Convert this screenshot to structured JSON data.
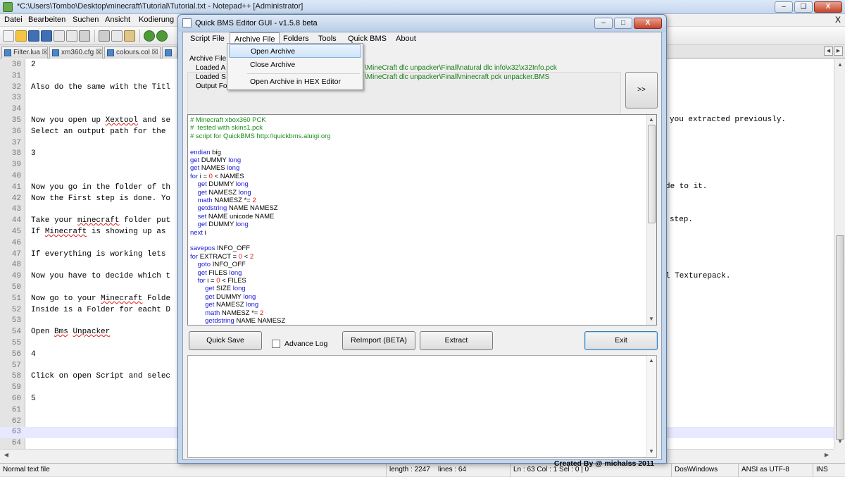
{
  "npp": {
    "title": "*C:\\Users\\Tombo\\Desktop\\minecraft\\Tutorial\\Tutorial.txt - Notepad++ [Administrator]",
    "menu": [
      "Datei",
      "Bearbeiten",
      "Suchen",
      "Ansicht",
      "Kodierung"
    ],
    "menu_close": "X",
    "tabs": [
      "Filter.lua",
      "xm360.cfg",
      "colours.col"
    ],
    "lines": [
      {
        "num": "30",
        "text": "2"
      },
      {
        "num": "31",
        "text": ""
      },
      {
        "num": "32",
        "text": "Also do the same with the Titl"
      },
      {
        "num": "33",
        "text": ""
      },
      {
        "num": "34",
        "text": ""
      },
      {
        "num": "35",
        "text": "Now you open up Xextool and se"
      },
      {
        "num": "36",
        "text": "Select an output path for the"
      },
      {
        "num": "37",
        "text": ""
      },
      {
        "num": "38",
        "text": "3"
      },
      {
        "num": "39",
        "text": ""
      },
      {
        "num": "40",
        "text": ""
      },
      {
        "num": "41",
        "text": "Now you go in the folder of th"
      },
      {
        "num": "42",
        "text": "Now the First step is done. Yo"
      },
      {
        "num": "43",
        "text": ""
      },
      {
        "num": "44",
        "text": "Take your minecraft folder put"
      },
      {
        "num": "45",
        "text": "If Minecraft is showing up as"
      },
      {
        "num": "46",
        "text": ""
      },
      {
        "num": "47",
        "text": "If everything is working lets"
      },
      {
        "num": "48",
        "text": ""
      },
      {
        "num": "49",
        "text": "Now you have to decide which t"
      },
      {
        "num": "50",
        "text": ""
      },
      {
        "num": "51",
        "text": "Now go to your Minecraft Folde"
      },
      {
        "num": "52",
        "text": "Inside is a Folder for eacht D"
      },
      {
        "num": "53",
        "text": ""
      },
      {
        "num": "54",
        "text": "Open Bms Unpacker"
      },
      {
        "num": "55",
        "text": ""
      },
      {
        "num": "56",
        "text": "4"
      },
      {
        "num": "57",
        "text": ""
      },
      {
        "num": "58",
        "text": "Click on open Script and selec"
      },
      {
        "num": "59",
        "text": ""
      },
      {
        "num": "60",
        "text": "5"
      },
      {
        "num": "61",
        "text": ""
      },
      {
        "num": "62",
        "text": ""
      },
      {
        "num": "63",
        "text": ""
      },
      {
        "num": "64",
        "text": ""
      }
    ],
    "right_texts": {
      "l35": "you extracted previously.",
      "l41": "de to it.",
      "l44": "step.",
      "l49": "l Texturepack."
    },
    "status": {
      "type": "Normal text file",
      "length": "length : 2247",
      "lines": "lines : 64",
      "pos": "Ln : 63   Col : 1   Sel : 0 | 0",
      "eol": "Dos\\Windows",
      "encoding": "ANSI as UTF-8",
      "mode": "INS"
    }
  },
  "qbms": {
    "title": "Quick BMS Editor GUI - v1.5.8 beta",
    "menu": [
      "Script File",
      "Archive File",
      "Folders",
      "Tools",
      "Quick BMS",
      "About"
    ],
    "archive_label": "Archive File",
    "loaded_archive_label": "Loaded A",
    "loaded_script_label": "Loaded S",
    "output_label": "Output Fo",
    "loaded_archive_path": "\\MineCraft dlc unpacker\\Finall\\natural dlc info\\x32\\x32Info.pck",
    "loaded_script_path": "\\MineCraft dlc unpacker\\Finall\\minecraft pck unpacker.BMS",
    "next_button": ">>",
    "script_lines": [
      [
        [
          "c-cm",
          "# Minecraft xbox360 PCK"
        ]
      ],
      [
        [
          "c-cm",
          "#  tested with skins1.pck"
        ]
      ],
      [
        [
          "c-cm",
          "# script for QuickBMS http://quickbms.aluigi.org"
        ]
      ],
      [
        [
          "",
          ""
        ]
      ],
      [
        [
          "c-kw",
          "endian"
        ],
        [
          "",
          " big"
        ]
      ],
      [
        [
          "c-kw",
          "get"
        ],
        [
          "",
          " DUMMY "
        ],
        [
          "c-kw",
          "long"
        ]
      ],
      [
        [
          "c-kw",
          "get"
        ],
        [
          "",
          " NAMES "
        ],
        [
          "c-kw",
          "long"
        ]
      ],
      [
        [
          "c-kw",
          "for"
        ],
        [
          "",
          " i = "
        ],
        [
          "c-nm",
          "0"
        ],
        [
          "",
          " < NAMES"
        ]
      ],
      [
        [
          "",
          "    "
        ],
        [
          "c-kw",
          "get"
        ],
        [
          "",
          " DUMMY "
        ],
        [
          "c-kw",
          "long"
        ]
      ],
      [
        [
          "",
          "    "
        ],
        [
          "c-kw",
          "get"
        ],
        [
          "",
          " NAMESZ "
        ],
        [
          "c-kw",
          "long"
        ]
      ],
      [
        [
          "",
          "    "
        ],
        [
          "c-kw",
          "math"
        ],
        [
          "",
          " NAMESZ *= "
        ],
        [
          "c-nm",
          "2"
        ]
      ],
      [
        [
          "",
          "    "
        ],
        [
          "c-kw",
          "getdstring"
        ],
        [
          "",
          " NAME NAMESZ"
        ]
      ],
      [
        [
          "",
          "    "
        ],
        [
          "c-kw",
          "set"
        ],
        [
          "",
          " NAME unicode NAME"
        ]
      ],
      [
        [
          "",
          "    "
        ],
        [
          "c-kw",
          "get"
        ],
        [
          "",
          " DUMMY "
        ],
        [
          "c-kw",
          "long"
        ]
      ],
      [
        [
          "c-kw",
          "next"
        ],
        [
          "",
          " i"
        ]
      ],
      [
        [
          "",
          ""
        ]
      ],
      [
        [
          "c-kw",
          "savepos"
        ],
        [
          "",
          " INFO_OFF"
        ]
      ],
      [
        [
          "c-kw",
          "for"
        ],
        [
          "",
          " EXTRACT = "
        ],
        [
          "c-nm",
          "0"
        ],
        [
          "",
          " < "
        ],
        [
          "c-nm",
          "2"
        ]
      ],
      [
        [
          "",
          "    "
        ],
        [
          "c-kw",
          "goto"
        ],
        [
          "",
          " INFO_OFF"
        ]
      ],
      [
        [
          "",
          "    "
        ],
        [
          "c-kw",
          "get"
        ],
        [
          "",
          " FILES "
        ],
        [
          "c-kw",
          "long"
        ]
      ],
      [
        [
          "",
          "    "
        ],
        [
          "c-kw",
          "for"
        ],
        [
          "",
          " i = "
        ],
        [
          "c-nm",
          "0"
        ],
        [
          "",
          " < FILES"
        ]
      ],
      [
        [
          "",
          "        "
        ],
        [
          "c-kw",
          "get"
        ],
        [
          "",
          " SIZE "
        ],
        [
          "c-kw",
          "long"
        ]
      ],
      [
        [
          "",
          "        "
        ],
        [
          "c-kw",
          "get"
        ],
        [
          "",
          " DUMMY "
        ],
        [
          "c-kw",
          "long"
        ]
      ],
      [
        [
          "",
          "        "
        ],
        [
          "c-kw",
          "get"
        ],
        [
          "",
          " NAMESZ "
        ],
        [
          "c-kw",
          "long"
        ]
      ],
      [
        [
          "",
          "        "
        ],
        [
          "c-kw",
          "math"
        ],
        [
          "",
          " NAMESZ *= "
        ],
        [
          "c-nm",
          "2"
        ]
      ],
      [
        [
          "",
          "        "
        ],
        [
          "c-kw",
          "getdstring"
        ],
        [
          "",
          " NAME NAMESZ"
        ]
      ]
    ],
    "buttons": {
      "quick_save": "Quick Save",
      "advance_log": "Advance Log",
      "reimport": "ReImport (BETA)",
      "extract": "Extract",
      "exit": "Exit"
    },
    "credits": "Created By @ michalss 2011",
    "archive_menu": [
      "Open Archive",
      "Close Archive",
      "Open Archive in HEX Editor"
    ]
  },
  "colors": {
    "comment": "#1c8c1c",
    "keyword": "#1b1bd6",
    "number": "#e31414",
    "path": "#197c19"
  }
}
